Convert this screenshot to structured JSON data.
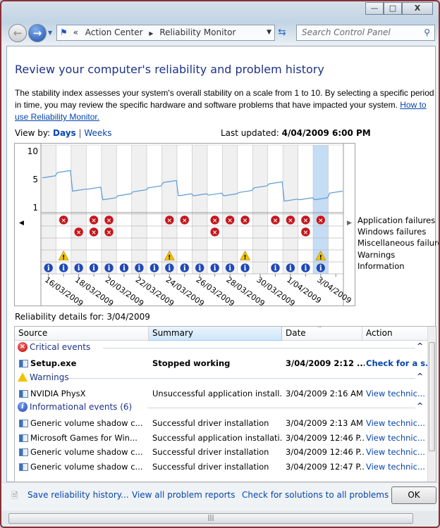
{
  "window": {
    "controls": [
      "minimize",
      "maximize",
      "close"
    ]
  },
  "nav": {
    "breadcrumb": [
      "Action Center",
      "Reliability Monitor"
    ],
    "overflow": "«",
    "search_placeholder": "Search Control Panel"
  },
  "page": {
    "title": "Review your computer's reliability and problem history",
    "description_line1": "The stability index assesses your system's overall stability on a scale from 1 to 10. By selecting a specific period",
    "description_line2": "in time, you may review the specific hardware and software problems that have impacted your system.",
    "help_link_part1": "How to",
    "help_link_part2": "use Reliability Monitor.",
    "view_by_label": "View by:",
    "view_days": "Days",
    "view_sep": "|",
    "view_weeks": "Weeks",
    "last_updated_label": "Last updated:",
    "last_updated_value": "4/04/2009 6:00 PM",
    "details_for": "Reliability details for: 3/04/2009"
  },
  "chart_data": {
    "type": "line",
    "ylim": [
      1,
      10
    ],
    "yticks": [
      "10",
      "5",
      "1"
    ],
    "x": [
      "16/03/2009",
      "17/03/2009",
      "18/03/2009",
      "19/03/2009",
      "20/03/2009",
      "21/03/2009",
      "22/03/2009",
      "23/03/2009",
      "24/03/2009",
      "25/03/2009",
      "26/03/2009",
      "27/03/2009",
      "28/03/2009",
      "29/03/2009",
      "30/03/2009",
      "31/03/2009",
      "1/04/2009",
      "2/04/2009",
      "3/04/2009",
      "4/04/2009"
    ],
    "xtick_labels": [
      "16/03/2009",
      "18/03/2009",
      "20/03/2009",
      "22/03/2009",
      "24/03/2009",
      "26/03/2009",
      "28/03/2009",
      "30/03/2009",
      "1/04/2009",
      "3/04/2009"
    ],
    "stability_index": [
      5.7,
      6.5,
      3.7,
      4.0,
      2.4,
      3.0,
      3.6,
      4.2,
      5.0,
      3.0,
      3.0,
      3.1,
      3.0,
      3.5,
      4.2,
      4.8,
      2.2,
      2.4,
      2.4,
      3.4
    ],
    "selected": "3/04/2009",
    "line_color": "#5b9bd5",
    "selected_color": "#c5dcf5",
    "event_rows": [
      {
        "label": "Application failures",
        "icon": "error",
        "days": [
          "17/03/2009",
          "19/03/2009",
          "20/03/2009",
          "24/03/2009",
          "25/03/2009",
          "27/03/2009",
          "28/03/2009",
          "29/03/2009",
          "31/03/2009",
          "1/04/2009",
          "2/04/2009",
          "3/04/2009"
        ]
      },
      {
        "label": "Windows failures",
        "icon": "error",
        "days": [
          "18/03/2009",
          "19/03/2009",
          "20/03/2009",
          "27/03/2009",
          "2/04/2009"
        ]
      },
      {
        "label": "Miscellaneous failures",
        "icon": "error",
        "days": []
      },
      {
        "label": "Warnings",
        "icon": "warning",
        "days": [
          "17/03/2009",
          "24/03/2009",
          "29/03/2009",
          "3/04/2009"
        ]
      },
      {
        "label": "Information",
        "icon": "info",
        "days": [
          "16/03/2009",
          "17/03/2009",
          "18/03/2009",
          "19/03/2009",
          "20/03/2009",
          "21/03/2009",
          "22/03/2009",
          "23/03/2009",
          "24/03/2009",
          "25/03/2009",
          "26/03/2009",
          "27/03/2009",
          "28/03/2009",
          "29/03/2009",
          "31/03/2009",
          "1/04/2009",
          "2/04/2009",
          "3/04/2009"
        ]
      }
    ]
  },
  "table": {
    "columns": [
      "Source",
      "Summary",
      "Date",
      "Action"
    ],
    "groups": [
      {
        "label": "Critical events",
        "icon": "error",
        "rows": [
          {
            "source": "Setup.exe",
            "summary": "Stopped working",
            "date": "3/04/2009 2:12 ...",
            "action": "Check for a s...",
            "bold": true
          }
        ]
      },
      {
        "label": "Warnings",
        "icon": "warning",
        "rows": [
          {
            "source": "NVIDIA PhysX",
            "summary": "Unsuccessful application install...",
            "date": "3/04/2009 2:16 AM",
            "action": "View  technic..."
          }
        ]
      },
      {
        "label": "Informational events (6)",
        "icon": "info",
        "rows": [
          {
            "source": "Generic volume shadow c...",
            "summary": "Successful driver installation",
            "date": "3/04/2009 2:13 AM",
            "action": "View  technic..."
          },
          {
            "source": "Microsoft Games for Win...",
            "summary": "Successful application installati...",
            "date": "3/04/2009 12:46 P...",
            "action": "View  technic..."
          },
          {
            "source": "Generic volume shadow c...",
            "summary": "Successful driver installation",
            "date": "3/04/2009 12:46 P...",
            "action": "View  technic..."
          },
          {
            "source": "Generic volume shadow c...",
            "summary": "Successful driver installation",
            "date": "3/04/2009 12:47 P...",
            "action": "View  technic..."
          }
        ]
      }
    ]
  },
  "footer": {
    "save_history": "Save reliability history...",
    "view_all": "View all problem reports",
    "check_solutions": "Check for solutions to all problems ...",
    "ok": "OK"
  }
}
